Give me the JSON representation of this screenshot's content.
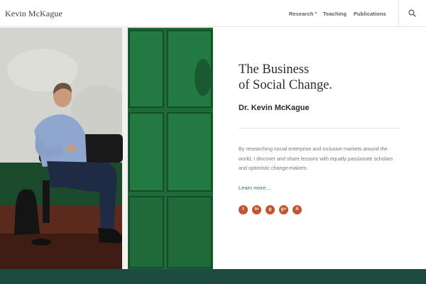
{
  "header": {
    "brand": "Kevin McKague",
    "nav": [
      {
        "label": "Research"
      },
      {
        "label": "Teaching"
      },
      {
        "label": "Publications"
      }
    ]
  },
  "hero": {
    "headline_line1": "The Business",
    "headline_line2": "of Social Change.",
    "subtitle": "Dr. Kevin McKague",
    "intro": "By researching social enterprise and inclusive markets around the world, I discover and share lessons with equally passionate scholars and optimistic change-makers.",
    "more_label": "Learn more...",
    "socials": [
      {
        "icon": "twitter-icon",
        "glyph": "t"
      },
      {
        "icon": "linkedin-icon",
        "glyph": "in"
      },
      {
        "icon": "googleplus-icon",
        "glyph": "g"
      },
      {
        "icon": "google-scholar-icon",
        "glyph": "g+"
      },
      {
        "icon": "academia-icon",
        "glyph": "A"
      }
    ]
  },
  "colors": {
    "accent_social": "#c1552f",
    "link": "#2f6c73",
    "band": "#1c4a3e",
    "door_green": "#1f6a38"
  }
}
